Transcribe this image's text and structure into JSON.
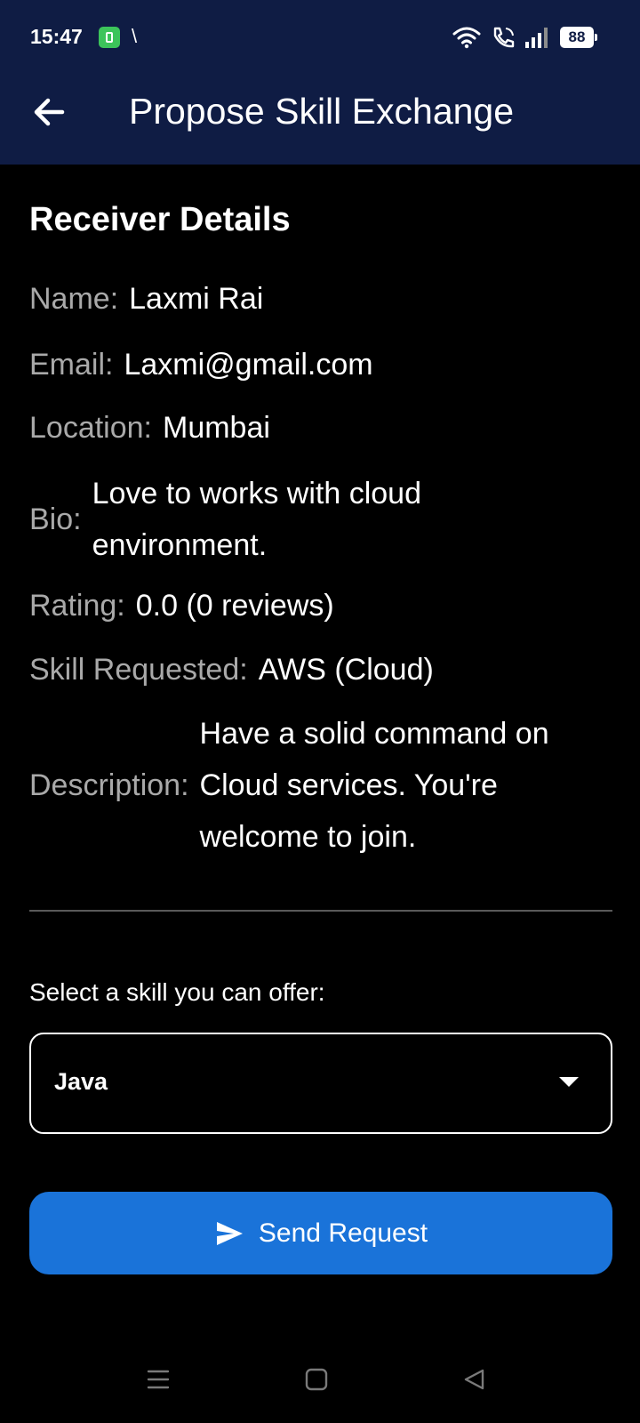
{
  "status_bar": {
    "time": "15:47",
    "extra_mark": "\\",
    "battery": "88",
    "icons": [
      "green-app-icon",
      "wifi-icon",
      "call-icon",
      "signal-icon",
      "battery-icon"
    ]
  },
  "app_bar": {
    "title": "Propose Skill Exchange",
    "back_icon": "arrow-left-icon",
    "background_color": "#0f1c44"
  },
  "receiver": {
    "heading": "Receiver Details",
    "name_label": "Name:",
    "name": "Laxmi Rai",
    "email_label": "Email:",
    "email": "Laxmi@gmail.com",
    "location_label": "Location:",
    "location": "Mumbai",
    "bio_label": "Bio:",
    "bio": "Love to works with cloud environment.",
    "rating_label": "Rating:",
    "rating": "0.0 (0 reviews)",
    "skill_label": "Skill Requested:",
    "skill": "AWS (Cloud)",
    "description_label": "Description:",
    "description": "Have a solid command on Cloud services. You're welcome to join."
  },
  "offer": {
    "label": "Select a skill you can offer:",
    "selected": "Java",
    "dropdown_icon": "caret-down-icon"
  },
  "actions": {
    "send_label": "Send Request",
    "send_icon": "send-icon",
    "accent_color": "#1a73d9"
  },
  "system_nav": {
    "icons": [
      "menu-icon",
      "home-icon",
      "back-icon"
    ]
  }
}
